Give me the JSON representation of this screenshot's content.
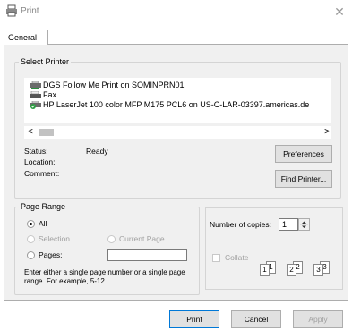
{
  "window": {
    "title": "Print",
    "close_glyph": "✕"
  },
  "tabs": [
    {
      "label": "General"
    }
  ],
  "select_printer": {
    "legend": "Select Printer",
    "printers": [
      {
        "name": "DGS Follow Me Print on SOMINPRN01",
        "icon": "network-printer-icon"
      },
      {
        "name": "Fax",
        "icon": "fax-icon"
      },
      {
        "name": "HP LaserJet 100 color MFP M175 PCL6 on US-C-LAR-03397.americas.de",
        "icon": "default-network-printer-icon",
        "selected": true
      }
    ],
    "scroll_left": "<",
    "scroll_right": ">",
    "status_label": "Status:",
    "status_value": "Ready",
    "location_label": "Location:",
    "comment_label": "Comment:",
    "preferences_label": "Preferences",
    "find_printer_label": "Find Printer..."
  },
  "page_range": {
    "legend": "Page Range",
    "all_label": "All",
    "selection_label": "Selection",
    "current_page_label": "Current Page",
    "pages_label": "Pages:",
    "hint": "Enter either a single page number or a single page range.  For example, 5-12"
  },
  "copies": {
    "label": "Number of copies:",
    "value": "1",
    "collate_label": "Collate",
    "collate_pages": [
      "1",
      "1",
      "2",
      "2",
      "3",
      "3"
    ]
  },
  "footer": {
    "print_label": "Print",
    "cancel_label": "Cancel",
    "apply_label": "Apply"
  },
  "colors": {
    "accent": "#0078d7",
    "panel": "#f0f0f0",
    "disabled": "#a0a0a0"
  }
}
